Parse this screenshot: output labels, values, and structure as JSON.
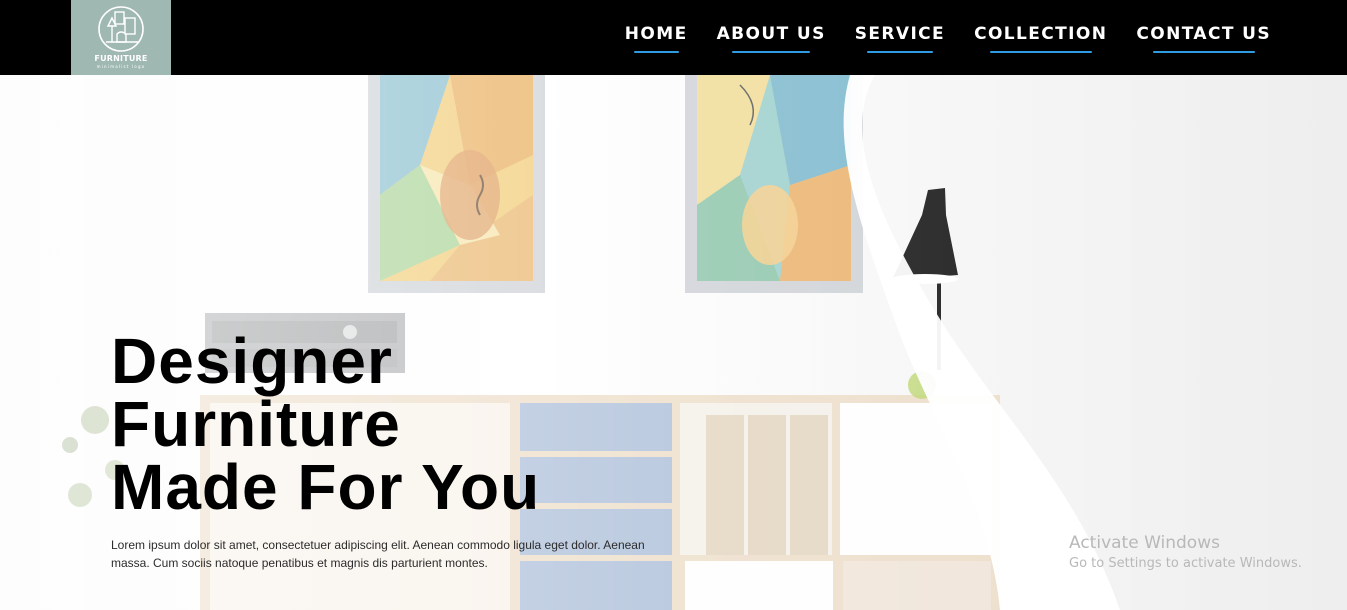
{
  "header": {
    "logo": {
      "name": "FURNITURE",
      "tagline": "minimalist logo",
      "icon": "furniture-logo-icon",
      "background_color": "#9fb8b2"
    },
    "nav": [
      {
        "label": "HOME"
      },
      {
        "label": "ABOUT US"
      },
      {
        "label": "SERVICE"
      },
      {
        "label": "COLLECTION"
      },
      {
        "label": "CONTACT US"
      }
    ],
    "nav_underline_color": "#2f9be0",
    "background_color": "#000000"
  },
  "hero": {
    "title_lines": [
      "Designer",
      "Furniture",
      "Made For You"
    ],
    "text": "Lorem ipsum dolor sit amet, consectetuer adipiscing elit. Aenean commodo ligula eget dolor. Aenean massa. Cum sociis natoque penatibus et magnis dis parturient montes.",
    "background_image": "living-room-with-paintings-lamp-and-shelf"
  },
  "watermark": {
    "title": "Activate Windows",
    "subtitle": "Go to Settings to activate Windows."
  }
}
